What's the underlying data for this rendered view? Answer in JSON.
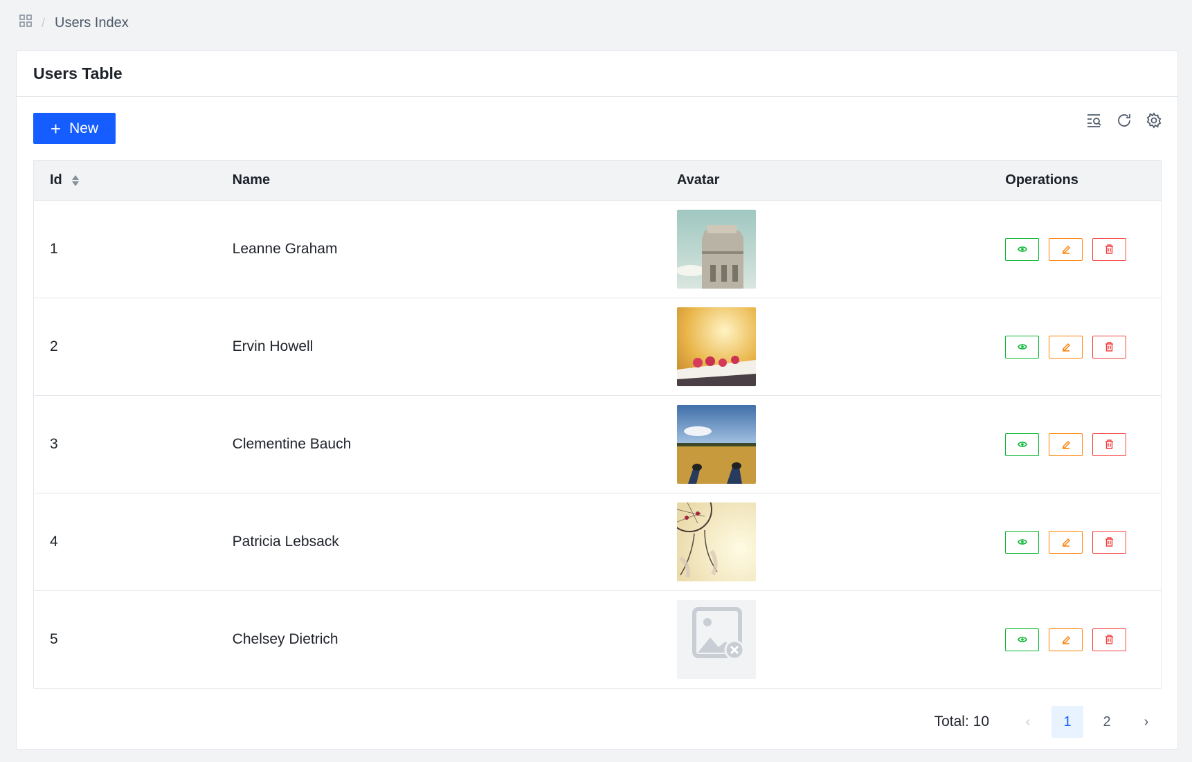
{
  "breadcrumb": {
    "icon": "apps-grid-icon",
    "separator": "/",
    "current": "Users Index"
  },
  "card": {
    "title": "Users Table"
  },
  "toolbar": {
    "new_label": "New",
    "icons": [
      "table-search-icon",
      "refresh-icon",
      "settings-icon"
    ]
  },
  "table": {
    "columns": {
      "id": "Id",
      "name": "Name",
      "avatar": "Avatar",
      "operations": "Operations"
    },
    "rows": [
      {
        "id": "1",
        "name": "Leanne Graham",
        "avatar": "photo-concrete-bunker"
      },
      {
        "id": "2",
        "name": "Ervin Howell",
        "avatar": "photo-raspberries"
      },
      {
        "id": "3",
        "name": "Clementine Bauch",
        "avatar": "photo-field-feet"
      },
      {
        "id": "4",
        "name": "Patricia Lebsack",
        "avatar": "photo-dreamcatcher"
      },
      {
        "id": "5",
        "name": "Chelsey Dietrich",
        "avatar": "image-broken-placeholder"
      }
    ]
  },
  "pagination": {
    "total_label": "Total: 10",
    "pages": [
      "1",
      "2"
    ],
    "current_page": "1"
  },
  "colors": {
    "primary": "#165dff",
    "view": "#00b42a",
    "edit": "#ff7d00",
    "delete": "#f53f3f"
  }
}
